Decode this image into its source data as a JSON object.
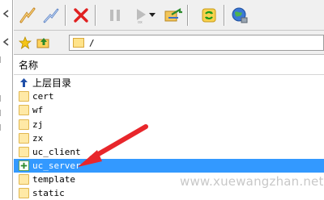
{
  "toolbar": {
    "buttons": [
      {
        "icon": "connect-lightning-icon"
      },
      {
        "icon": "disconnect-icon"
      },
      {
        "icon": "cancel-x-icon",
        "color": "#e02020"
      },
      {
        "icon": "pause-icon"
      },
      {
        "icon": "play-icon"
      },
      {
        "icon": "dropdown-arrow-icon"
      },
      {
        "icon": "transfer-icon"
      },
      {
        "icon": "refresh-icon",
        "color": "#1a9a1a"
      },
      {
        "icon": "globe-icon"
      }
    ]
  },
  "address": {
    "path": "/"
  },
  "list": {
    "header": "名称",
    "up_item": "上层目录",
    "items": [
      {
        "name": "cert"
      },
      {
        "name": "wf"
      },
      {
        "name": "zj"
      },
      {
        "name": "zx"
      },
      {
        "name": "uc_client"
      },
      {
        "name": "uc_server",
        "selected": true
      },
      {
        "name": "template"
      },
      {
        "name": "static"
      }
    ]
  },
  "watermark": "www.xuewangzhan.net",
  "colors": {
    "selection": "#3399ff",
    "arrow": "#e8262b",
    "folder": "#ffe9a6"
  }
}
